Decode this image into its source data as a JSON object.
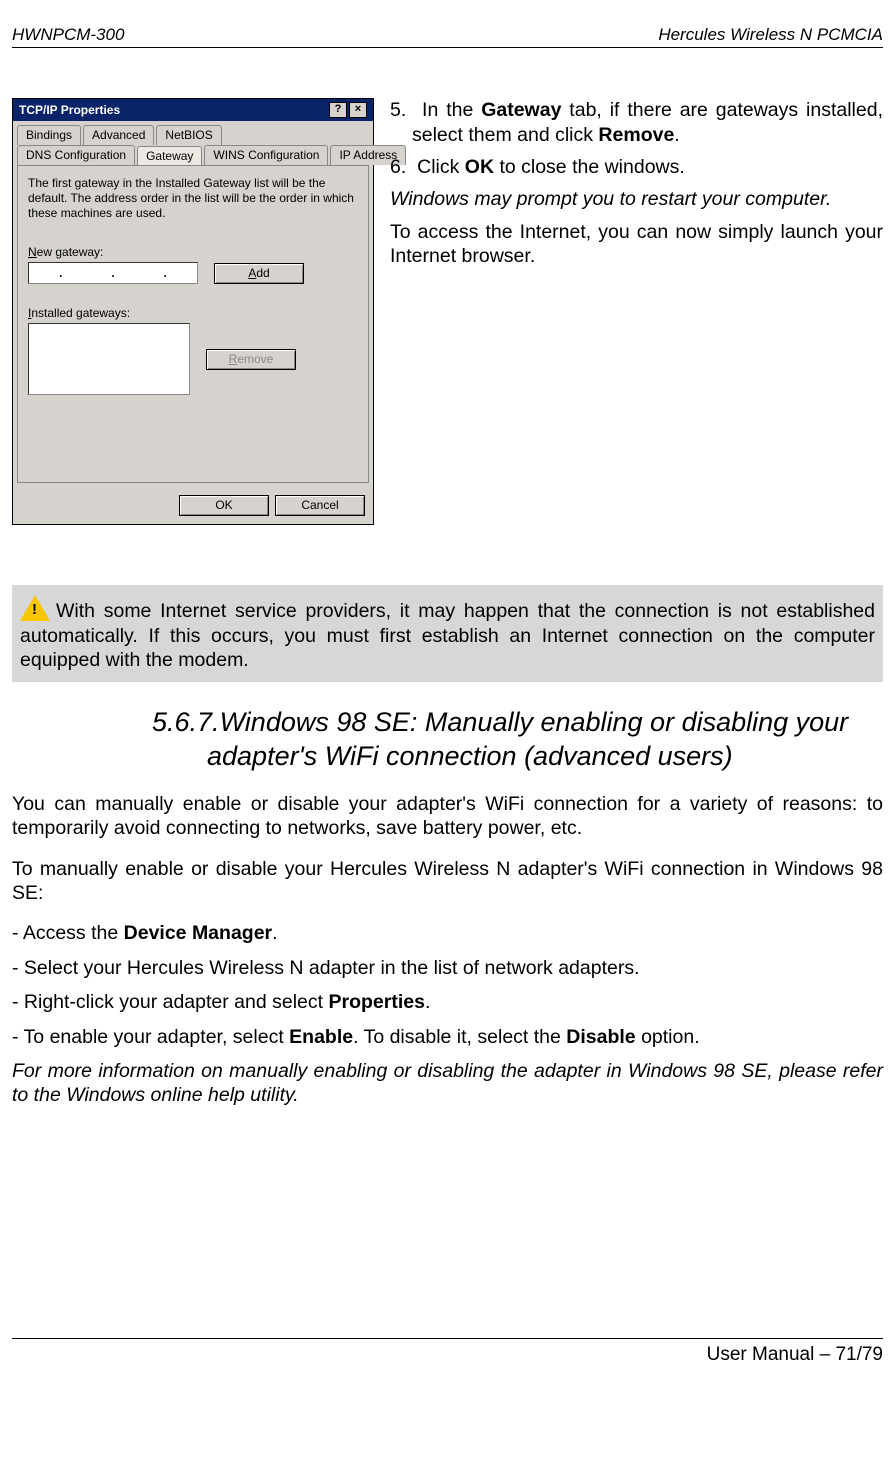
{
  "header": {
    "left": "HWNPCM-300",
    "right": "Hercules Wireless N PCMCIA"
  },
  "dialog": {
    "title": "TCP/IP Properties",
    "tabs_row1": [
      "Bindings",
      "Advanced",
      "NetBIOS"
    ],
    "tabs_row2": [
      "DNS Configuration",
      "Gateway",
      "WINS Configuration",
      "IP Address"
    ],
    "active_tab": "Gateway",
    "panel_text": "The first gateway in the Installed Gateway list will be the default. The address order in the list will be the order in which these machines are used.",
    "new_gateway_label_pre": "N",
    "new_gateway_label": "ew gateway:",
    "add_btn_pre": "A",
    "add_btn": "dd",
    "installed_label_pre": "I",
    "installed_label": "nstalled gateways:",
    "remove_btn_pre": "R",
    "remove_btn": "emove",
    "ok": "OK",
    "cancel": "Cancel"
  },
  "steps": {
    "s5_num": "5.",
    "s5_a": "In the ",
    "s5_b": "Gateway",
    "s5_c": " tab, if there are gateways installed, select them and click ",
    "s5_d": "Remove",
    "s5_e": ".",
    "s6_num": "6.",
    "s6_a": "Click ",
    "s6_b": "OK",
    "s6_c": " to close the windows.",
    "p_restart": "Windows may prompt you to restart your computer.",
    "p_access": "To access the Internet, you can now simply launch your Internet browser."
  },
  "note": {
    "text": "With some Internet service providers, it may happen that the connection is not established automatically.  If this occurs, you must first establish an Internet connection on the computer equipped with the modem."
  },
  "section": {
    "num": "5.6.7.",
    "title": "Windows 98 SE: Manually enabling or disabling your adapter's WiFi connection (advanced users)"
  },
  "body": {
    "p1": "You can manually enable or disable your adapter's WiFi connection for a variety of reasons: to temporarily avoid connecting to networks, save battery power, etc.",
    "p2": "To manually enable or disable your Hercules Wireless N adapter's WiFi connection in Windows 98 SE:",
    "l1_a": "- Access the ",
    "l1_b": "Device Manager",
    "l1_c": ".",
    "l2": "- Select your Hercules Wireless N adapter in the list of network adapters.",
    "l3_a": "- Right-click your adapter and select ",
    "l3_b": "Properties",
    "l3_c": ".",
    "l4_a": "- To enable your adapter, select ",
    "l4_b": "Enable",
    "l4_c": ".  To disable it, select the ",
    "l4_d": "Disable",
    "l4_e": " option.",
    "p3": "For more information on manually enabling or disabling the adapter in Windows 98 SE, please refer to the Windows online help utility."
  },
  "footer": {
    "text": "User Manual – 71/79"
  }
}
